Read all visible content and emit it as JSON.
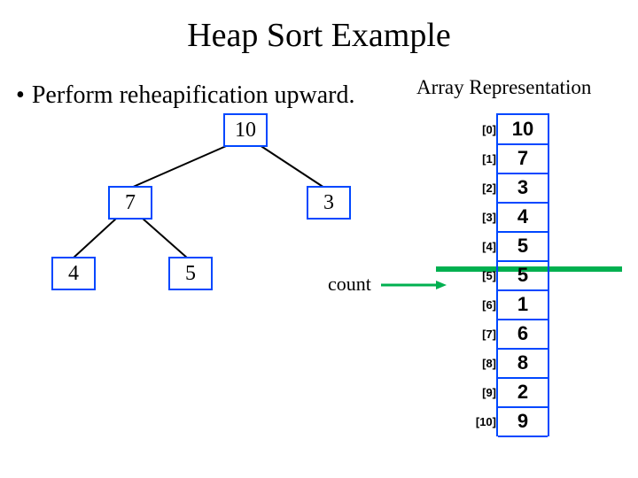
{
  "title": "Heap Sort Example",
  "bullet_text": "Perform reheapification upward.",
  "array_title": "Array Representation",
  "count_label": "count",
  "tree": {
    "root": "10",
    "left": "7",
    "right": "3",
    "left_left": "4",
    "left_right": "5"
  },
  "array": [
    {
      "idx": "[0]",
      "val": "10"
    },
    {
      "idx": "[1]",
      "val": "7"
    },
    {
      "idx": "[2]",
      "val": "3"
    },
    {
      "idx": "[3]",
      "val": "4"
    },
    {
      "idx": "[4]",
      "val": "5"
    },
    {
      "idx": "[5]",
      "val": "5"
    },
    {
      "idx": "[6]",
      "val": "1"
    },
    {
      "idx": "[7]",
      "val": "6"
    },
    {
      "idx": "[8]",
      "val": "8"
    },
    {
      "idx": "[9]",
      "val": "2"
    },
    {
      "idx": "[10]",
      "val": "9"
    }
  ],
  "count_index": 5
}
